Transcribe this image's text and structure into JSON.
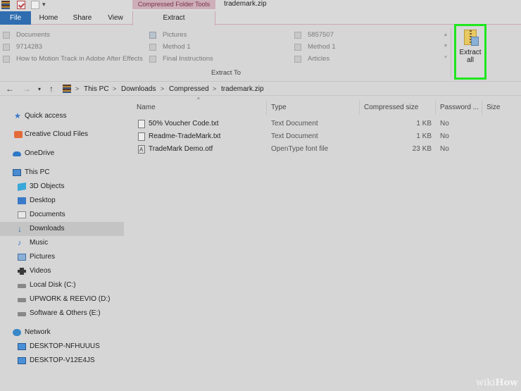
{
  "window": {
    "context_tab_group": "Compressed Folder Tools",
    "title": "trademark.zip"
  },
  "tabs": {
    "file": "File",
    "home": "Home",
    "share": "Share",
    "view": "View",
    "extract": "Extract"
  },
  "ribbon": {
    "destinations": [
      "Documents",
      "Pictures",
      "5857507",
      "9714283",
      "Method 1",
      "Method 1",
      "How to Motion Track in Adobe After Effects",
      "Final Instructions",
      "Articles"
    ],
    "group_label": "Extract To",
    "extract_all_label": "Extract all",
    "extract_all_line1": "Extract",
    "extract_all_line2": "all"
  },
  "address": {
    "crumbs": [
      "This PC",
      "Downloads",
      "Compressed",
      "trademark.zip"
    ]
  },
  "nav": {
    "items": [
      "Quick access",
      "Creative Cloud Files",
      "OneDrive",
      "This PC",
      "3D Objects",
      "Desktop",
      "Documents",
      "Downloads",
      "Music",
      "Pictures",
      "Videos",
      "Local Disk (C:)",
      "UPWORK & REEVIO (D:)",
      "Software & Others (E:)",
      "Network",
      "DESKTOP-NFHUUUS",
      "DESKTOP-V12E4JS"
    ],
    "selected": "Downloads"
  },
  "columns": {
    "name": "Name",
    "type": "Type",
    "compressed_size": "Compressed size",
    "password": "Password ...",
    "size": "Size"
  },
  "files": [
    {
      "name": "50% Voucher Code.txt",
      "type": "Text Document",
      "compressed_size": "1 KB",
      "password": "No"
    },
    {
      "name": "Readme-TradeMark.txt",
      "type": "Text Document",
      "compressed_size": "1 KB",
      "password": "No"
    },
    {
      "name": "TradeMark Demo.otf",
      "type": "OpenType font file",
      "compressed_size": "23 KB",
      "password": "No"
    }
  ],
  "watermark": {
    "wiki": "wiki",
    "how": "How"
  }
}
